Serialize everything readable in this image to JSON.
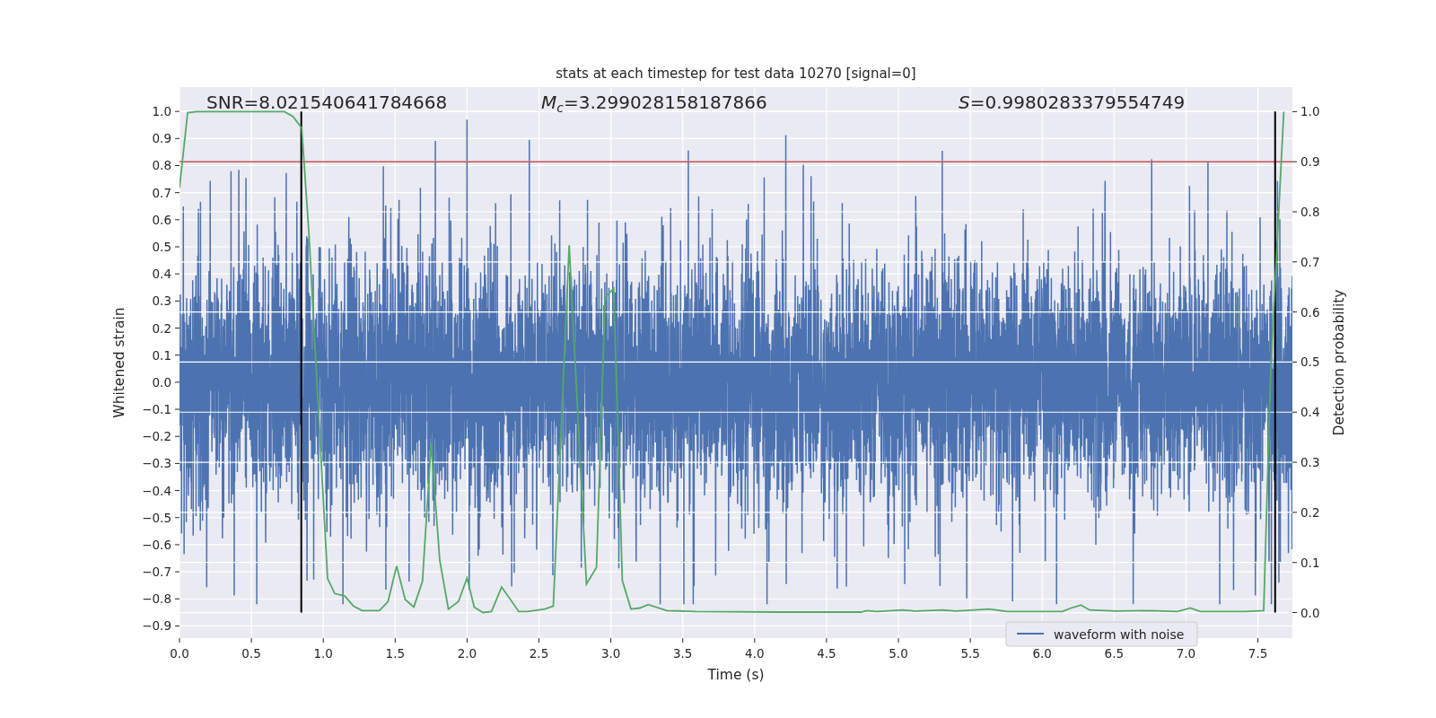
{
  "figure": {
    "annotations": [
      "SNR=8.021540641784668",
      "*M*$_{c}$=3.299028158187866",
      "*S*=0.9980283379554749"
    ],
    "chart_data": {
      "type": "line",
      "title": "stats at each timestep for test data 10270 [signal=0]",
      "xlabel": "Time (s)",
      "ylabel": "Whitened strain",
      "y2label": "Detection probability",
      "grid": true,
      "xlim": [
        0,
        7.74
      ],
      "ylim": [
        -0.945,
        1.09
      ],
      "y2lim": [
        -0.051,
        1.049
      ],
      "xticks": [
        {
          "value": 0,
          "label": "0.0"
        },
        {
          "value": 0.5,
          "label": "0.5"
        },
        {
          "value": 1,
          "label": "1.0"
        },
        {
          "value": 1.5,
          "label": "1.5"
        },
        {
          "value": 2,
          "label": "2.0"
        },
        {
          "value": 2.5,
          "label": "2.5"
        },
        {
          "value": 3,
          "label": "3.0"
        },
        {
          "value": 3.5,
          "label": "3.5"
        },
        {
          "value": 4,
          "label": "4.0"
        },
        {
          "value": 4.5,
          "label": "4.5"
        },
        {
          "value": 5,
          "label": "5.0"
        },
        {
          "value": 5.5,
          "label": "5.5"
        },
        {
          "value": 6,
          "label": "6.0"
        },
        {
          "value": 6.5,
          "label": "6.5"
        },
        {
          "value": 7,
          "label": "7.0"
        },
        {
          "value": 7.5,
          "label": "7.5"
        }
      ],
      "yticks": [
        {
          "value": 1,
          "label": "1.0"
        },
        {
          "value": 0.9,
          "label": "0.9"
        },
        {
          "value": 0.8,
          "label": "0.8"
        },
        {
          "value": 0.7,
          "label": "0.7"
        },
        {
          "value": 0.6,
          "label": "0.6"
        },
        {
          "value": 0.5,
          "label": "0.5"
        },
        {
          "value": 0.4,
          "label": "0.4"
        },
        {
          "value": 0.3,
          "label": "0.3"
        },
        {
          "value": 0.2,
          "label": "0.2"
        },
        {
          "value": 0.1,
          "label": "0.1"
        },
        {
          "value": 0,
          "label": "0.0"
        },
        {
          "value": -0.1,
          "label": "−0.1"
        },
        {
          "value": -0.2,
          "label": "−0.2"
        },
        {
          "value": -0.3,
          "label": "−0.3"
        },
        {
          "value": -0.4,
          "label": "−0.4"
        },
        {
          "value": -0.5,
          "label": "−0.5"
        },
        {
          "value": -0.6,
          "label": "−0.6"
        },
        {
          "value": -0.7,
          "label": "−0.7"
        },
        {
          "value": -0.8,
          "label": "−0.8"
        },
        {
          "value": -0.9,
          "label": "−0.9"
        }
      ],
      "y2ticks": [
        {
          "value": 1,
          "label": "1.0"
        },
        {
          "value": 0.9,
          "label": "0.9"
        },
        {
          "value": 0.8,
          "label": "0.8"
        },
        {
          "value": 0.7,
          "label": "0.7"
        },
        {
          "value": 0.6,
          "label": "0.6"
        },
        {
          "value": 0.5,
          "label": "0.5"
        },
        {
          "value": 0.4,
          "label": "0.4"
        },
        {
          "value": 0.3,
          "label": "0.3"
        },
        {
          "value": 0.2,
          "label": "0.2"
        },
        {
          "value": 0.1,
          "label": "0.1"
        },
        {
          "value": 0,
          "label": "0.0"
        }
      ],
      "x": [
        0,
        0.057,
        0.12,
        0.73,
        0.79,
        0.85,
        0.9,
        0.95,
        1.03,
        1.08,
        1.15,
        1.21,
        1.27,
        1.39,
        1.45,
        1.51,
        1.57,
        1.63,
        1.69,
        1.75,
        1.81,
        1.87,
        1.94,
        2.0,
        2.05,
        2.11,
        2.17,
        2.24,
        2.36,
        2.42,
        2.54,
        2.6,
        2.71,
        2.83,
        2.9,
        2.96,
        3.02,
        3.08,
        3.14,
        3.2,
        3.26,
        3.39,
        3.59,
        4.17,
        4.74,
        4.78,
        4.85,
        5.03,
        5.12,
        5.31,
        5.4,
        5.63,
        5.76,
        6.14,
        6.2,
        6.27,
        6.33,
        6.52,
        6.75,
        6.94,
        7.03,
        7.1,
        7.41,
        7.54,
        7.59,
        7.68
      ],
      "series": [
        {
          "axis": "y2",
          "color": "#55a868",
          "values": [
            0.848,
            0.998,
            1.0,
            1.0,
            0.99,
            0.967,
            0.757,
            0.49,
            0.068,
            0.038,
            0.033,
            0.013,
            0.004,
            0.004,
            0.022,
            0.093,
            0.026,
            0.011,
            0.062,
            0.338,
            0.104,
            0.007,
            0.022,
            0.069,
            0.011,
            0.0,
            0.002,
            0.051,
            0.002,
            0.002,
            0.007,
            0.013,
            0.733,
            0.057,
            0.09,
            0.629,
            0.647,
            0.064,
            0.007,
            0.009,
            0.016,
            0.004,
            0.002,
            0.001,
            0.001,
            0.004,
            0.002,
            0.005,
            0.003,
            0.005,
            0.003,
            0.007,
            0.002,
            0.002,
            0.009,
            0.015,
            0.005,
            0.003,
            0.004,
            0.002,
            0.009,
            0.002,
            0.002,
            0.004,
            0.49,
            1.0
          ]
        }
      ],
      "ref_lines": [
        {
          "axis": "y2",
          "value": 0.9,
          "color": "#c44e52"
        },
        {
          "axis": "x",
          "value": 0.847,
          "color": "#000000"
        },
        {
          "axis": "x",
          "value": 7.62,
          "color": "#000000"
        }
      ]
    },
    "waveform": {
      "legend": "waveform with noise",
      "color": "#4c72b0"
    }
  }
}
